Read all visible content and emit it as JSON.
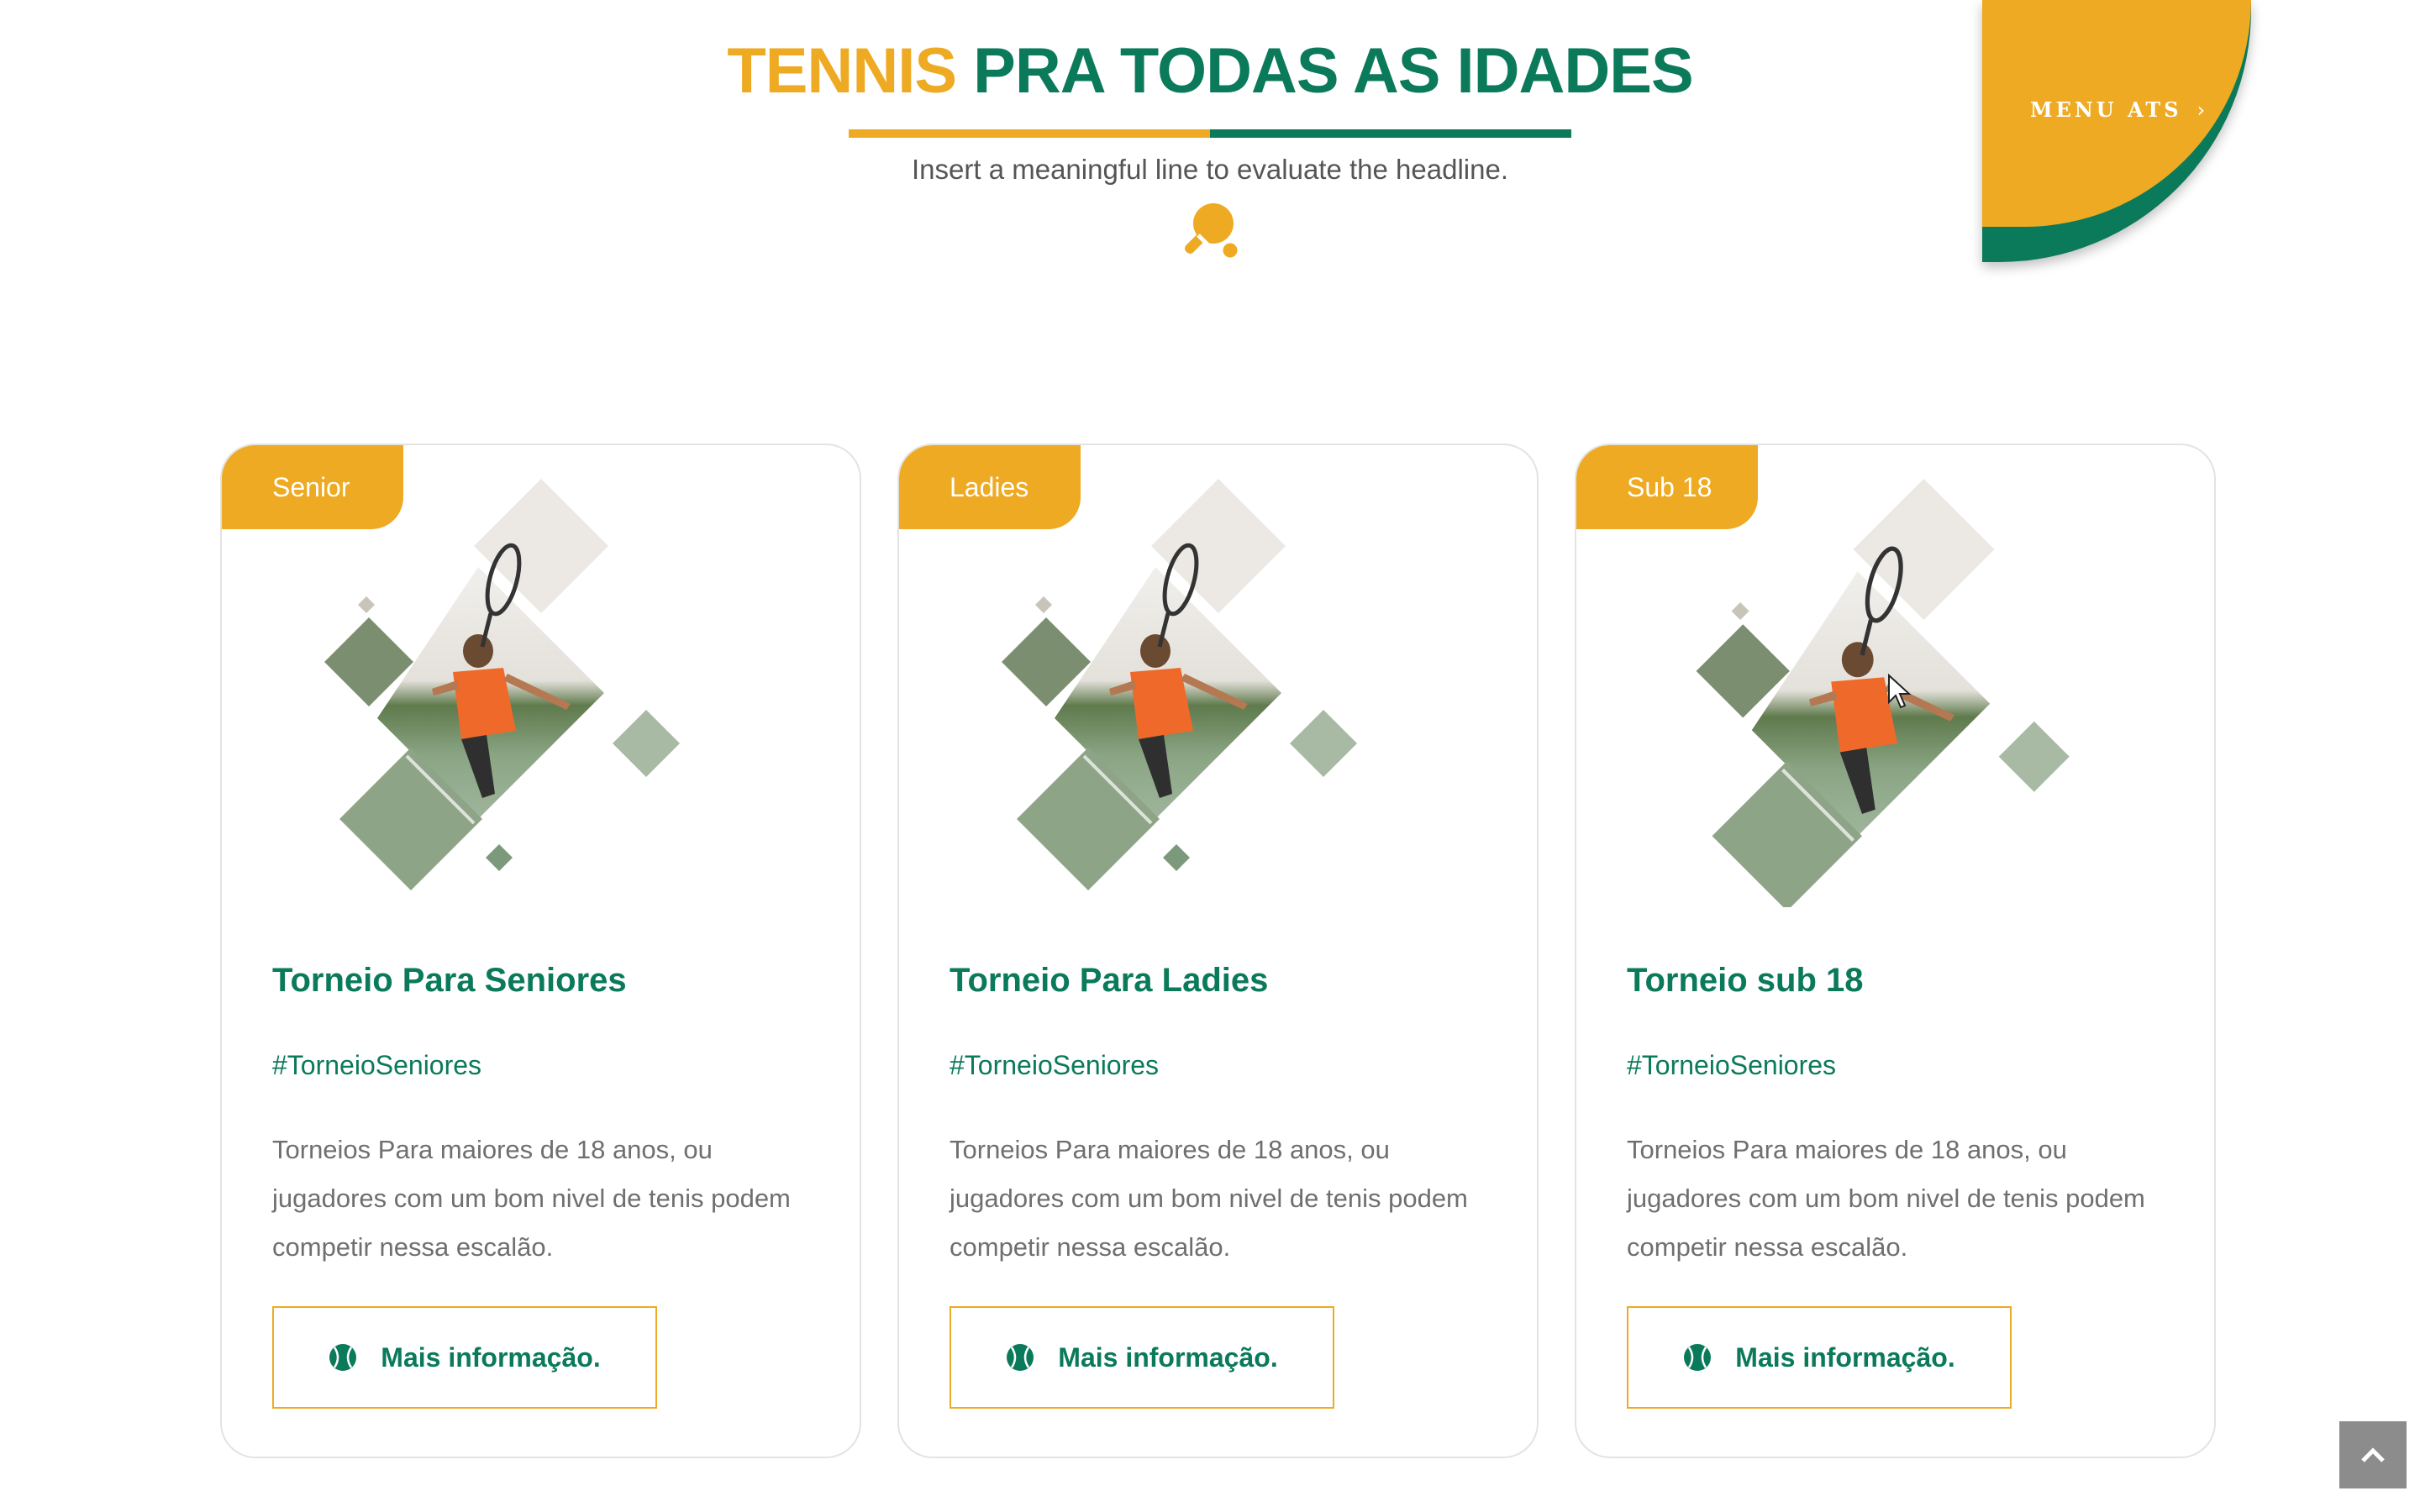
{
  "header": {
    "headline_part1": "TENNIS",
    "headline_part2": "PRA TODAS AS IDADES",
    "subline": "Insert a meaningful line to evaluate the headline.",
    "icon": "ping-pong-paddle-icon"
  },
  "corner_menu": {
    "label": "MENU ATS",
    "chevron": "›"
  },
  "colors": {
    "accent_yellow": "#eeaa22",
    "accent_green": "#0b7a5a",
    "body_text": "#6f6f6f"
  },
  "cards": [
    {
      "badge": "Senior",
      "title": "Torneio Para Seniores",
      "tag": "#TorneioSeniores",
      "description": "Torneios Para maiores de 18 anos, ou jugadores com um bom nivel de tenis podem competir nessa escalão.",
      "button_label": "Mais informação.",
      "button_icon": "tennis-ball-icon"
    },
    {
      "badge": "Ladies",
      "title": "Torneio Para Ladies",
      "tag": "#TorneioSeniores",
      "description": "Torneios Para maiores de 18 anos, ou jugadores com um bom nivel de tenis podem competir nessa escalão.",
      "button_label": "Mais informação.",
      "button_icon": "tennis-ball-icon"
    },
    {
      "badge": "Sub 18",
      "title": "Torneio sub 18",
      "tag": "#TorneioSeniores",
      "description": "Torneios Para maiores de 18 anos, ou jugadores com um bom nivel de tenis podem competir nessa escalão.",
      "button_label": "Mais informação.",
      "button_icon": "tennis-ball-icon"
    }
  ],
  "back_to_top": {
    "icon": "chevron-up-icon"
  }
}
